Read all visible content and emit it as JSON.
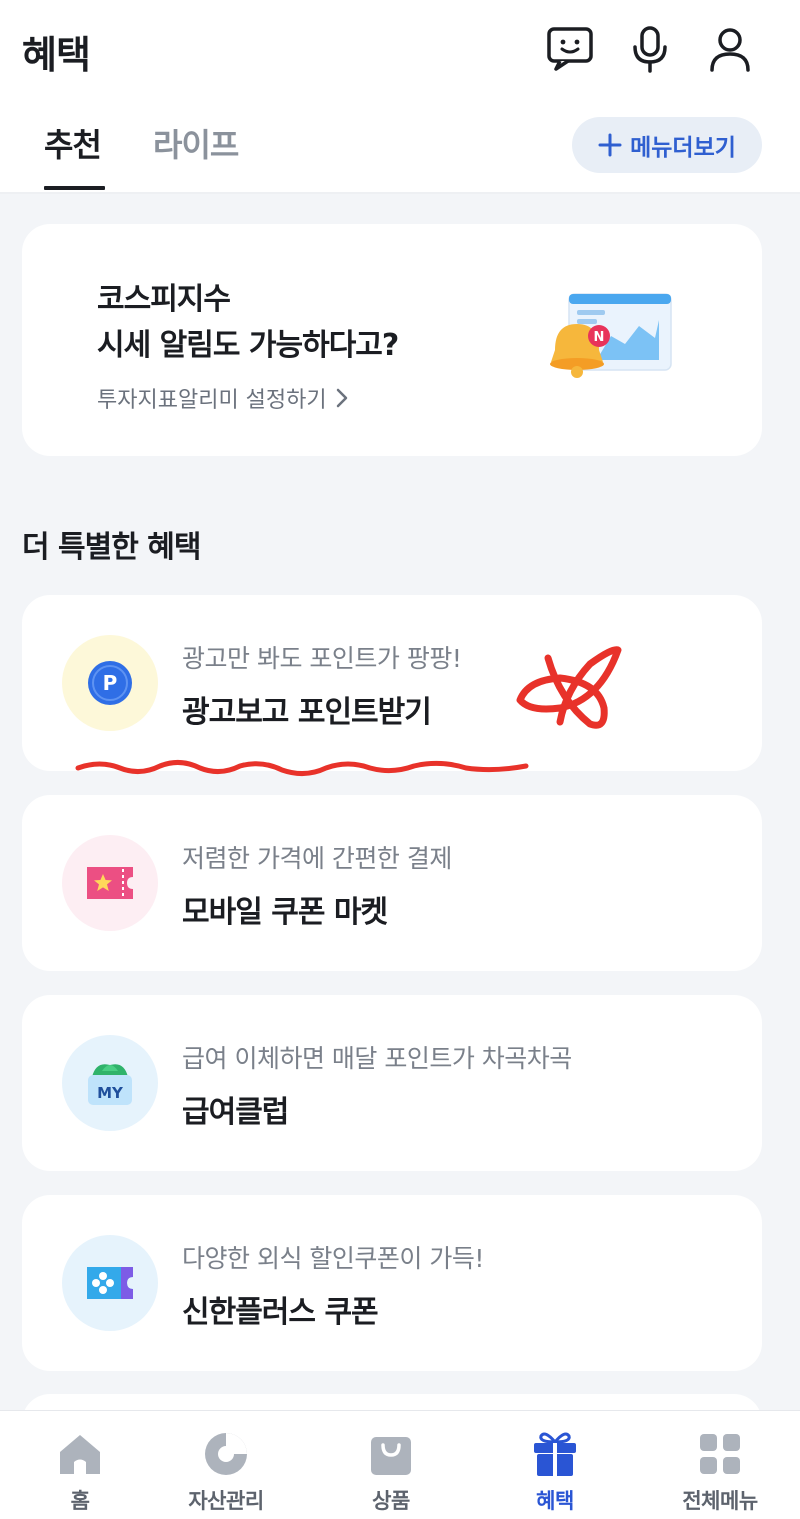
{
  "header": {
    "title": "혜택",
    "icons": [
      "chatbot-icon",
      "microphone-icon",
      "user-icon"
    ]
  },
  "tabs": {
    "items": [
      {
        "label": "추천",
        "active": true
      },
      {
        "label": "라이프",
        "active": false
      }
    ],
    "more_menu_label": "메뉴더보기"
  },
  "promo": {
    "line1": "코스피지수",
    "line2": "시세 알림도 가능하다고?",
    "link_label": "투자지표알리미 설정하기",
    "badge_letter": "N"
  },
  "section": {
    "title": "더 특별한 혜택"
  },
  "benefits": [
    {
      "subtitle": "광고만 봐도 포인트가 팡팡!",
      "title": "광고보고 포인트받기",
      "icon": "point-coin-icon",
      "icon_text": "P",
      "icon_bg": "#fdf8d9"
    },
    {
      "subtitle": "저렴한 가격에 간편한 결제",
      "title": "모바일 쿠폰 마켓",
      "icon": "ticket-star-icon",
      "icon_bg": "#fdeef3"
    },
    {
      "subtitle": "급여 이체하면 매달 포인트가 차곡차곡",
      "title": "급여클럽",
      "icon": "my-wallet-icon",
      "icon_text": "MY",
      "icon_bg": "#e6f3fc"
    },
    {
      "subtitle": "다양한 외식 할인쿠폰이 가득!",
      "title": "신한플러스 쿠폰",
      "icon": "plus-coupon-icon",
      "icon_bg": "#e6f3fc"
    }
  ],
  "bottom_nav": {
    "items": [
      {
        "label": "홈",
        "icon": "home-icon",
        "active": false
      },
      {
        "label": "자산관리",
        "icon": "pie-chart-icon",
        "active": false
      },
      {
        "label": "상품",
        "icon": "shopping-bag-icon",
        "active": false
      },
      {
        "label": "혜택",
        "icon": "gift-icon",
        "active": true
      },
      {
        "label": "전체메뉴",
        "icon": "grid-menu-icon",
        "active": false
      }
    ]
  },
  "colors": {
    "accent": "#2a55d4",
    "annotation": "#e8322a",
    "background": "#f3f5f8"
  }
}
